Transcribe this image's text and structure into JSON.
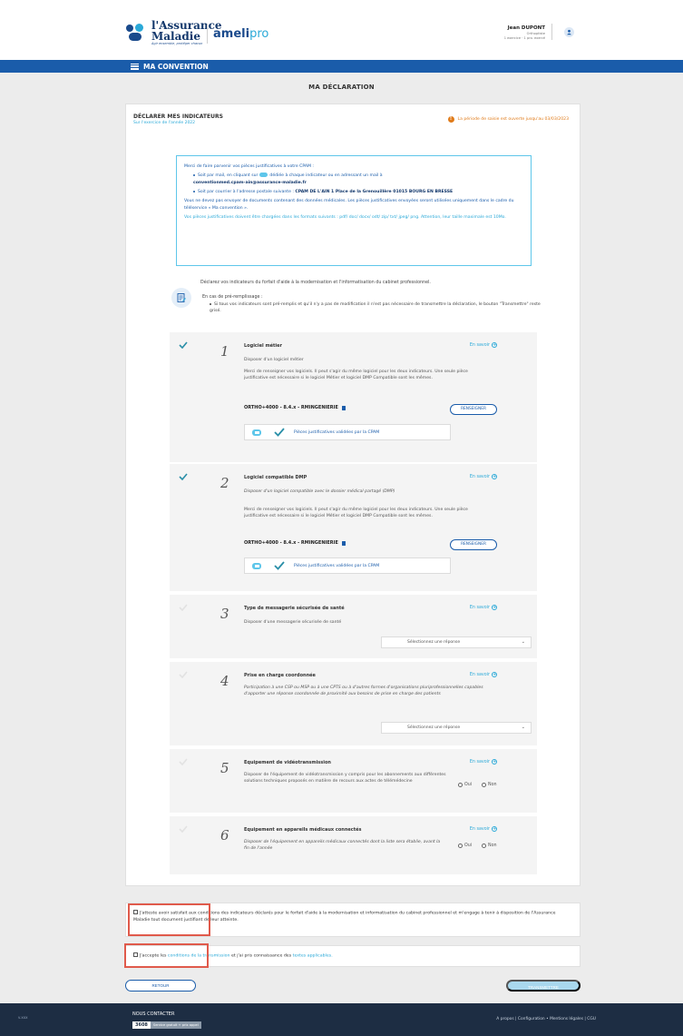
{
  "header": {
    "logo_line1": "l'Assurance",
    "logo_line2": "Maladie",
    "logo_tagline": "Agir ensemble, protéger chacun",
    "brand_ameli": "ameli",
    "brand_pro": "pro",
    "user_name": "Jean DUPONT",
    "user_role": "Orthoptiste",
    "user_extra": "1 exercice · 1 pro. exercé"
  },
  "nav": {
    "title": "MA CONVENTION"
  },
  "page": {
    "title": "MA DÉCLARATION"
  },
  "card": {
    "title": "DÉCLARER MES INDICATEURS",
    "subtitle": "Sur l'exercice de l'année 2022",
    "period_notice": "La période de saisie est ouverte jusqu'au 03/03/2023"
  },
  "info": {
    "intro": "Merci de faire parvenir vos pièces justificatives à votre CPAM :",
    "mail_a": "Soit par mail, en cliquant sur",
    "mail_b": "dédiée à chaque indicateur ou en adressant un mail à",
    "email": "conventionmed.cpam-ain@assurance-maladie.fr",
    "postal_a": "Soit par courrier à l'adresse postale suivante :",
    "postal_addr": "CPAM DE L'AIN 1 Place de la Grenouillère 01015 BOURG EN BRESSE",
    "warning": "Vous ne devez pas envoyer de documents contenant des données médicales. Les pièces justificatives envoyées seront utilisées uniquement dans le cadre du téléservice « Ma convention ».",
    "formats": "Vos pièces justificatives doivent être chargées dans les formats suivants : pdf/ doc/ docx/ odt/ zip/ txt/ jpeg/ png. Attention, leur taille maximale est 10Mo."
  },
  "declare_text": "Déclarez vos indicateurs du forfait d'aide à la modernisation et l'informatisation du cabinet professionnel.",
  "prefill": {
    "title": "En cas de pré-remplissage :",
    "note": "Si tous vos indicateurs sont pré-remplis et qu'il n'y a pas de modification il n'est pas nécessaire de transmettre la déclaration, le bouton \"Transmettre\" reste grisé."
  },
  "labels": {
    "learn_more": "En savoir",
    "fill_in": "RENSEIGNER",
    "validated": "Pièces justificatives validées par la CPAM",
    "select_placeholder": "Sélectionnez une réponse",
    "yes": "Oui",
    "no": "Non"
  },
  "indicators": [
    {
      "num": "1",
      "title": "Logiciel métier",
      "desc": "Disposer d'un logiciel métier",
      "note": "Merci de renseigner vos logiciels. Il peut s'agir du même logiciel pour les deux indicateurs. Une seule pièce justificative est nécessaire si le logiciel Métier et logiciel DMP Compatible sont les mêmes.",
      "software": "ORTHO+4000 - 8.4.x - RMINGENIERIE"
    },
    {
      "num": "2",
      "title": "Logiciel compatible DMP",
      "desc": "Disposer d'un logiciel compatible avec le dossier médical partagé (DMP)",
      "note": "Merci de renseigner vos logiciels. Il peut s'agir du même logiciel pour les deux indicateurs. Une seule pièce justificative est nécessaire si le logiciel Métier et logiciel DMP Compatible sont les mêmes.",
      "software": "ORTHO+4000 - 8.4.x - RMINGENIERIE"
    },
    {
      "num": "3",
      "title": "Type de messagerie sécurisée de santé",
      "desc": "Disposer d'une messagerie sécurisée de santé"
    },
    {
      "num": "4",
      "title": "Prise en charge coordonnée",
      "desc": "Participation à une CSP ou MSP ou à une CPTS ou à d'autres formes d'organisations pluriprofessionnelles capables d'apporter une réponse coordonnée de proximité aux besoins de prise en charge des patients"
    },
    {
      "num": "5",
      "title": "Equipement de vidéotransmission",
      "desc": "Disposer de l'équipement de vidéotransmission y compris pour les abonnements aux différentes solutions techniques proposés en matière de recours aux actes de télémédecine"
    },
    {
      "num": "6",
      "title": "Equipement en appareils médicaux connectés",
      "desc": "Disposer de l'équipement en appareils médicaux connectés dont la liste sera établie, avant la fin de l'année"
    }
  ],
  "agreements": {
    "attest": "J'atteste avoir satisfait aux conditions des indicateurs déclarés pour le forfait d'aide à la modernisation et informatisation du cabinet professionnel et m'engage à tenir à disposition de l'Assurance Maladie tout document justifiant de leur atteinte.",
    "accept_a": "J'accepte les",
    "accept_link1": "conditions de la transmission",
    "accept_b": "et j'ai pris connaissance des",
    "accept_link2": "textes applicables."
  },
  "buttons": {
    "back": "RETOUR",
    "submit": "TRANSMETTRE"
  },
  "footer": {
    "left": "v.xxx",
    "contact": "NOUS CONTACTER",
    "phone": "3608",
    "phone_tag": "Service gratuit + prix appel",
    "links": "A propos | Configuration  •  Mentions légales | CGU"
  },
  "colors": {
    "primary": "#1a5caa",
    "accent": "#2aa9d8",
    "warning": "#e07b1a",
    "highlight": "#e05a4b"
  }
}
